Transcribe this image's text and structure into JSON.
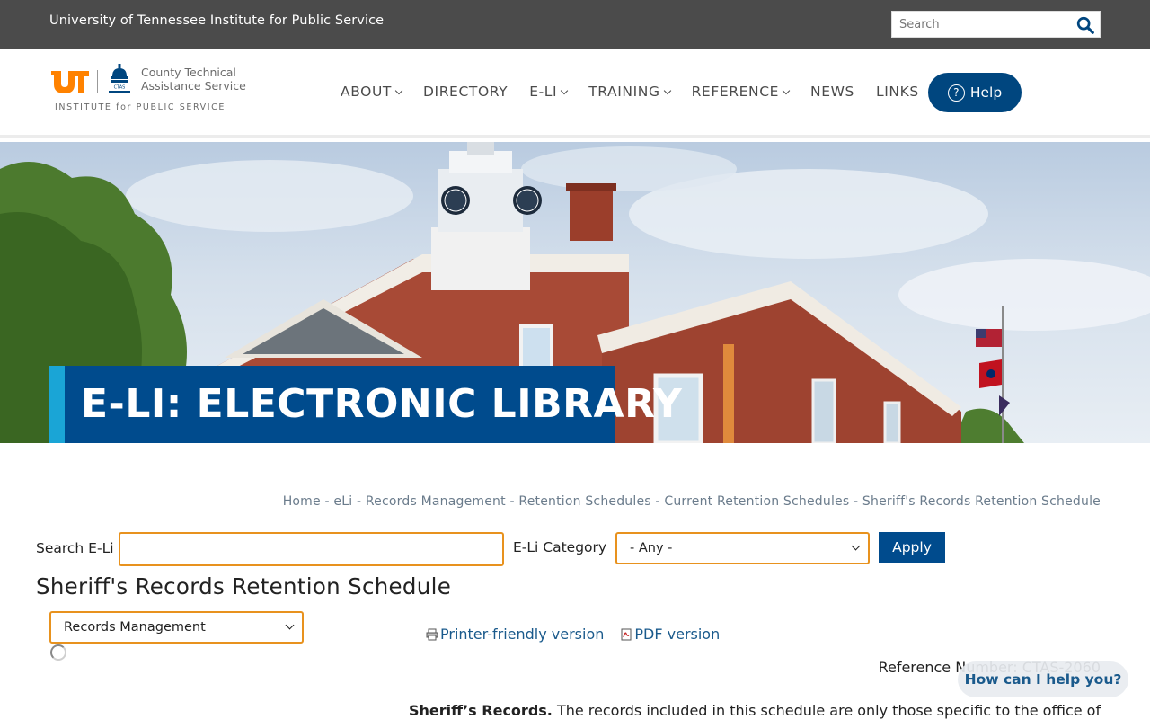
{
  "topbar": {
    "institute": "University of Tennessee Institute for Public Service",
    "search_placeholder": "Search"
  },
  "logo": {
    "ctas_line1": "County Technical",
    "ctas_line2": "Assistance Service",
    "institute_line": "INSTITUTE for PUBLIC SERVICE"
  },
  "nav": {
    "items": [
      {
        "label": "ABOUT",
        "dropdown": true
      },
      {
        "label": "DIRECTORY",
        "dropdown": false
      },
      {
        "label": "E-LI",
        "dropdown": true
      },
      {
        "label": "TRAINING",
        "dropdown": true
      },
      {
        "label": "REFERENCE",
        "dropdown": true
      },
      {
        "label": "NEWS",
        "dropdown": false
      },
      {
        "label": "LINKS",
        "dropdown": false
      }
    ],
    "help_label": "Help"
  },
  "hero": {
    "title": "E-LI: ELECTRONIC LIBRARY"
  },
  "breadcrumb": {
    "items": [
      "Home",
      "eLi",
      "Records Management",
      "Retention Schedules",
      "Current Retention Schedules",
      "Sheriff's Records Retention Schedule"
    ],
    "separator": " - "
  },
  "search": {
    "label": "Search E-Li",
    "value": "",
    "category_label": "E-Li Category",
    "category_value": "- Any -",
    "apply_label": "Apply"
  },
  "page": {
    "title": "Sheriff's Records Retention Schedule",
    "section_select": "Records Management",
    "printer_link": "Printer-friendly version",
    "pdf_link": "PDF version",
    "reference_number": "Reference Number: CTAS-2060",
    "body_lead": "Sheriff’s Records.",
    "body_text": " The records included in this schedule are only those specific to the office of"
  },
  "chat": {
    "label": "How can I help you?"
  },
  "colors": {
    "topbar_bg": "#4b4b4b",
    "brand_blue": "#004b8d",
    "accent_cyan": "#1aa5d6",
    "input_border_orange": "#e8921e",
    "ut_orange": "#ff8200"
  }
}
